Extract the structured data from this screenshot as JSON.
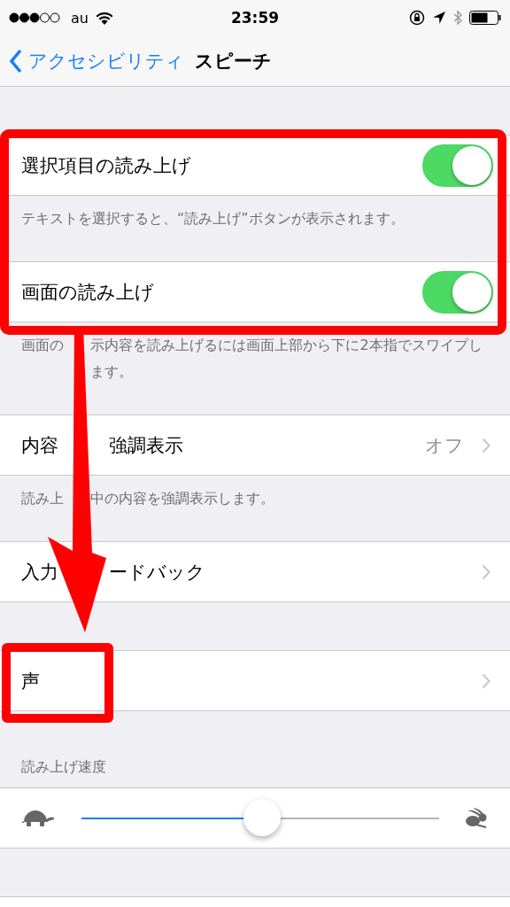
{
  "status_bar": {
    "carrier": "au",
    "time": "23:59"
  },
  "nav": {
    "back": "アクセシビリティ",
    "title": "スピーチ"
  },
  "sections": [
    {
      "rows": [
        {
          "kind": "toggle",
          "label": "選択項目の読み上げ",
          "on": true
        }
      ],
      "footer": "テキストを選択すると、“読み上げ”ボタンが表示されます。"
    },
    {
      "rows": [
        {
          "kind": "toggle",
          "label": "画面の読み上げ",
          "on": true
        }
      ],
      "footer": [
        "画面の",
        "示内容を読み上げるには画面上部から下に2本指でスワイプします。"
      ]
    },
    {
      "rows": [
        {
          "kind": "link",
          "label": [
            "内容",
            "強調表示"
          ],
          "value": "オフ"
        }
      ],
      "footer": [
        "読み上",
        "中の内容を強調表示します。"
      ]
    },
    {
      "rows": [
        {
          "kind": "link",
          "label": [
            "入力",
            "ードバック"
          ]
        }
      ]
    },
    {
      "rows": [
        {
          "kind": "link",
          "label": "声"
        }
      ]
    },
    {
      "header": "読み上げ速度",
      "rows": [
        {
          "kind": "slider",
          "level": 0.505
        }
      ]
    }
  ]
}
